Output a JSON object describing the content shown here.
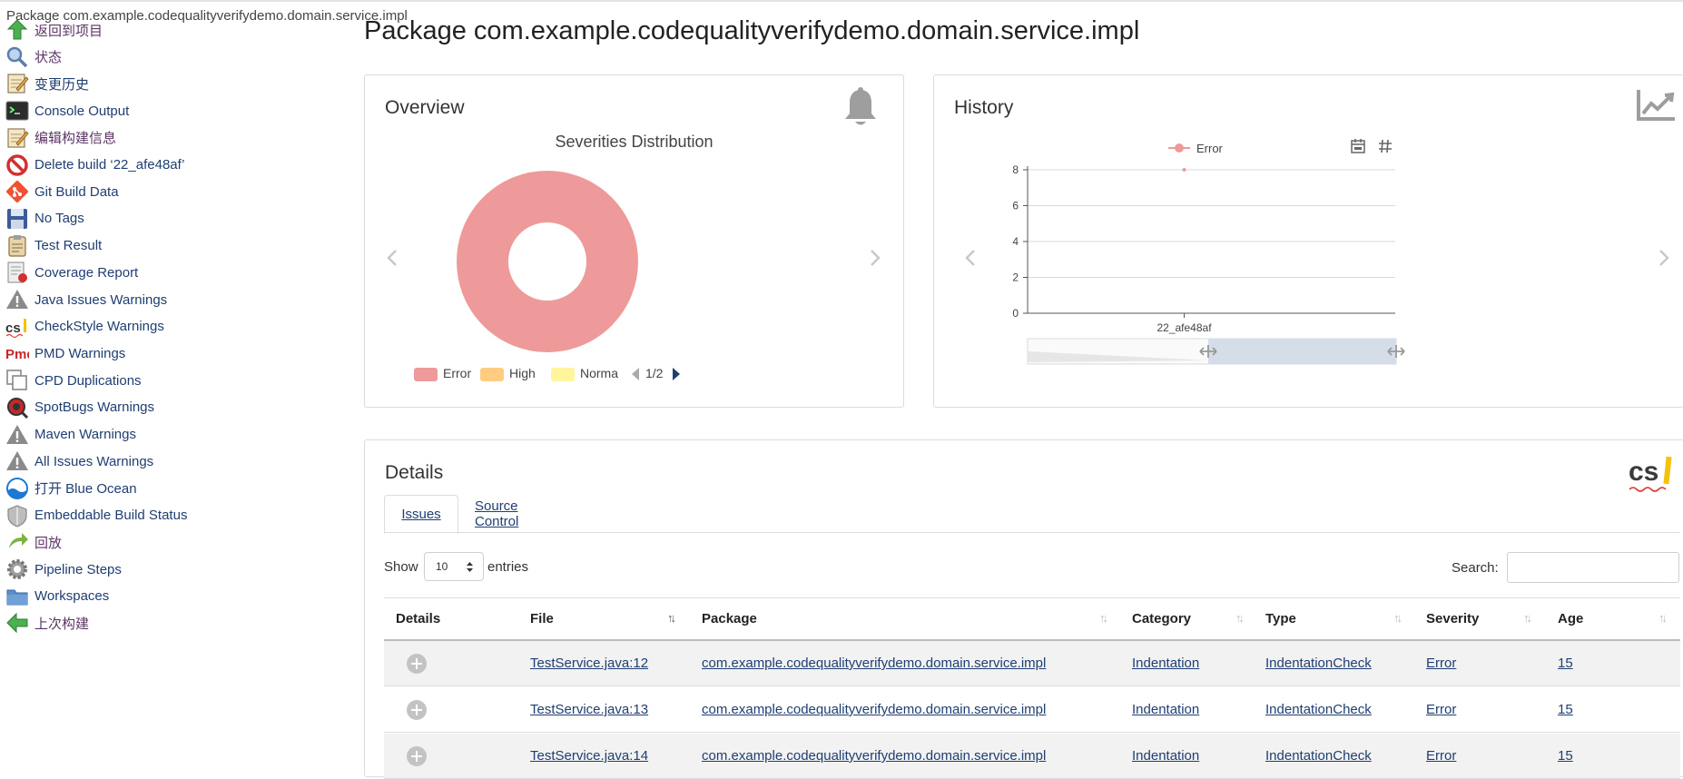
{
  "tab_tooltip": "Package com.example.codequalityverifydemo.domain.service.impl",
  "sidebar": {
    "items": [
      {
        "label": "返回到项目",
        "icon": "arrow-up-icon"
      },
      {
        "label": "状态",
        "icon": "magnifier-icon"
      },
      {
        "label": "变更历史",
        "icon": "notepad-icon"
      },
      {
        "label": "Console Output",
        "icon": "terminal-icon"
      },
      {
        "label": "编辑构建信息",
        "icon": "notepad-icon"
      },
      {
        "label": "Delete build ‘22_afe48af’",
        "icon": "no-entry-icon"
      },
      {
        "label": "Git Build Data",
        "icon": "git-icon"
      },
      {
        "label": "No Tags",
        "icon": "floppy-icon"
      },
      {
        "label": "Test Result",
        "icon": "clipboard-icon"
      },
      {
        "label": "Coverage Report",
        "icon": "coverage-icon"
      },
      {
        "label": "Java Issues Warnings",
        "icon": "warning-icon"
      },
      {
        "label": "CheckStyle Warnings",
        "icon": "checkstyle-icon"
      },
      {
        "label": "PMD Warnings",
        "icon": "pmd-icon"
      },
      {
        "label": "CPD Duplications",
        "icon": "duplicate-icon"
      },
      {
        "label": "SpotBugs Warnings",
        "icon": "spotbugs-icon"
      },
      {
        "label": "Maven Warnings",
        "icon": "warning-icon"
      },
      {
        "label": "All Issues Warnings",
        "icon": "warning-icon"
      },
      {
        "label": "打开 Blue Ocean",
        "icon": "blue-ocean-icon"
      },
      {
        "label": "Embeddable Build Status",
        "icon": "shield-icon"
      },
      {
        "label": "回放",
        "icon": "replay-icon"
      },
      {
        "label": "Pipeline Steps",
        "icon": "gear-icon"
      },
      {
        "label": "Workspaces",
        "icon": "folder-icon"
      },
      {
        "label": "上次构建",
        "icon": "arrow-left-icon"
      }
    ]
  },
  "page_title": "Package com.example.codequalityverifydemo.domain.service.impl",
  "overview": {
    "title": "Overview",
    "chart_title": "Severities Distribution",
    "legend": [
      {
        "label": "Error",
        "color": "#ef9a9a"
      },
      {
        "label": "High",
        "color": "#ffcc80"
      },
      {
        "label": "Norma",
        "color": "#fff59d"
      }
    ],
    "pager": "1/2"
  },
  "history": {
    "title": "History",
    "legend_label": "Error"
  },
  "details": {
    "title": "Details",
    "tabs": [
      "Issues",
      "Source Control"
    ],
    "show_label": "Show",
    "show_value": "10",
    "entries_label": "entries",
    "search_label": "Search:",
    "search_value": "",
    "columns": [
      "Details",
      "File",
      "Package",
      "Category",
      "Type",
      "Severity",
      "Age"
    ],
    "rows": [
      {
        "file": "TestService.java:12",
        "package": "com.example.codequalityverifydemo.domain.service.impl",
        "category": "Indentation",
        "type": "IndentationCheck",
        "severity": "Error",
        "age": "15"
      },
      {
        "file": "TestService.java:13",
        "package": "com.example.codequalityverifydemo.domain.service.impl",
        "category": "Indentation",
        "type": "IndentationCheck",
        "severity": "Error",
        "age": "15"
      },
      {
        "file": "TestService.java:14",
        "package": "com.example.codequalityverifydemo.domain.service.impl",
        "category": "Indentation",
        "type": "IndentationCheck",
        "severity": "Error",
        "age": "15"
      }
    ]
  },
  "chart_data": [
    {
      "type": "pie",
      "title": "Severities Distribution",
      "labels": [
        "Error",
        "High",
        "Norma"
      ],
      "values": [
        1,
        0,
        0
      ],
      "colors": [
        "#ef9a9a",
        "#ffcc80",
        "#fff59d"
      ],
      "donut": true,
      "legend": "bottom"
    },
    {
      "type": "line",
      "title": "",
      "categories": [
        "22_afe48af"
      ],
      "series": [
        {
          "name": "Error",
          "values": [
            8
          ],
          "color": "#ef9a9a"
        }
      ],
      "ylim": [
        0,
        8
      ],
      "yticks": [
        "0",
        "2",
        "4",
        "6",
        "8"
      ],
      "grid": true,
      "legend": "top"
    }
  ]
}
